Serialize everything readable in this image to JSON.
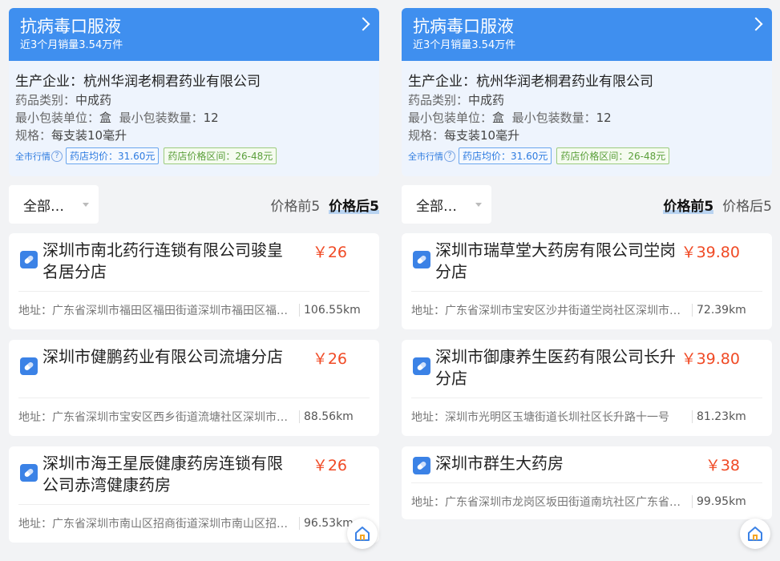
{
  "colors": {
    "accent": "#3f8fef",
    "price": "#f04a25",
    "page_bg": "#f2f3f5"
  },
  "panels": [
    {
      "drug": {
        "name": "抗病毒口服液",
        "sales": "近3个月销量3.54万件",
        "maker_label": "生产企业：",
        "maker": "杭州华润老桐君药业有限公司",
        "category_label": "药品类别：",
        "category": "中成药",
        "unit_label": "最小包装单位：",
        "unit": "盒",
        "qty_label": "最小包装数量：",
        "qty": "12",
        "spec_label": "规格：",
        "spec": "每支装10毫升",
        "market_label": "全市行情",
        "avg_price": "药店均价：31.60元",
        "price_range": "药店价格区间：26-48元"
      },
      "filter": {
        "select": "全部…",
        "sort_top": "价格前5",
        "sort_bottom": "价格后5",
        "active": "bottom"
      },
      "stores": [
        {
          "name": "深圳市南北药行连锁有限公司骏皇名居分店",
          "price": "￥26",
          "address": "地址：广东省深圳市福田区福田街道深圳市福田区福田路与福民路交汇处皇名居",
          "distance": "106.55km"
        },
        {
          "name": "深圳市健鹏药业有限公司流塘分店",
          "price": "￥26",
          "address": "地址：广东省深圳市宝安区西乡街道流塘社区深圳市宝安区西乡街道流塘社区",
          "distance": "88.56km"
        },
        {
          "name": "深圳市海王星辰健康药房连锁有限公司赤湾健康药房",
          "price": "￥26",
          "address": "地址：广东省深圳市南山区招商街道深圳市南山区招商街道赤湾社区",
          "distance": "96.53km"
        }
      ]
    },
    {
      "drug": {
        "name": "抗病毒口服液",
        "sales": "近3个月销量3.54万件",
        "maker_label": "生产企业：",
        "maker": "杭州华润老桐君药业有限公司",
        "category_label": "药品类别：",
        "category": "中成药",
        "unit_label": "最小包装单位：",
        "unit": "盒",
        "qty_label": "最小包装数量：",
        "qty": "12",
        "spec_label": "规格：",
        "spec": "每支装10毫升",
        "market_label": "全市行情",
        "avg_price": "药店均价：31.60元",
        "price_range": "药店价格区间：26-48元"
      },
      "filter": {
        "select": "全部…",
        "sort_top": "价格前5",
        "sort_bottom": "价格后5",
        "active": "top"
      },
      "stores": [
        {
          "name": "深圳市瑞草堂大药房有限公司坣岗分店",
          "price": "￥39.80",
          "address": "地址：广东省深圳市宝安区沙井街道坣岗社区深圳市宝安区沙井街道坣岗社区",
          "distance": "72.39km"
        },
        {
          "name": "深圳市御康养生医药有限公司长升分店",
          "price": "￥39.80",
          "address": "地址：深圳市光明区玉塘街道长圳社区长升路十一号",
          "distance": "81.23km"
        },
        {
          "name": "深圳市群生大药房",
          "price": "￥38",
          "address": "地址：广东省深圳市龙岗区坂田街道南坑社区广东省深圳市龙岗区坂田街道",
          "distance": "99.95km"
        }
      ]
    }
  ]
}
